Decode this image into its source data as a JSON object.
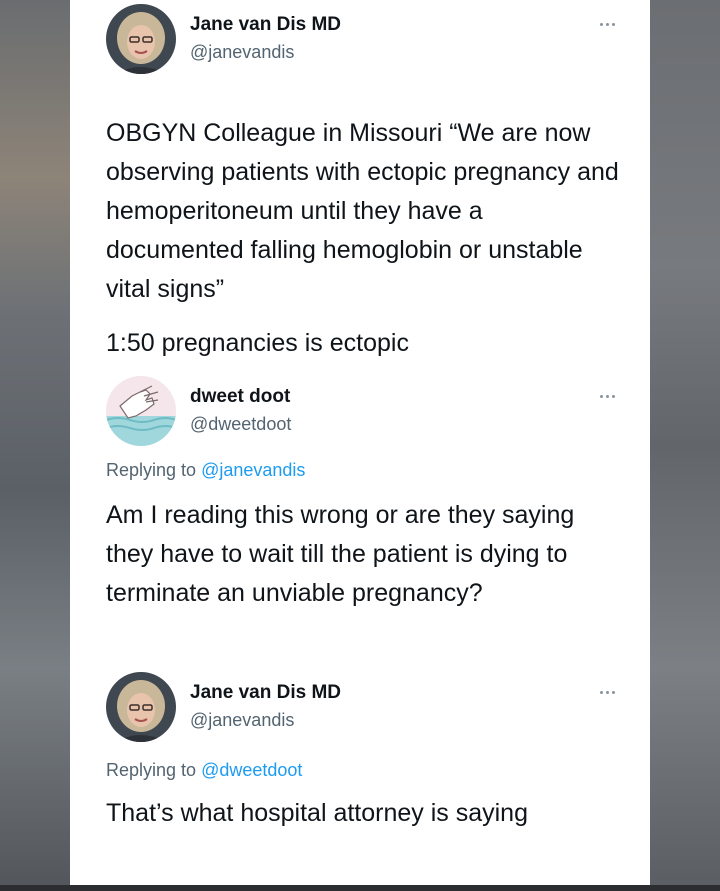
{
  "tweets": [
    {
      "author": "Jane van Dis MD",
      "handle": "@janevandis",
      "avatar": "portrait-photo",
      "more_icon": "more-horizontal-icon",
      "text": "OBGYN Colleague in Missouri “We are now observing patients with ectopic pregnancy and hemoperitoneum until they have a documented falling hemoglobin or unstable vital signs”",
      "text2": "1:50 pregnancies is ectopic"
    },
    {
      "author": "dweet doot",
      "handle": "@dweetdoot",
      "avatar": "hand-illustration",
      "more_icon": "more-horizontal-icon",
      "replying_prefix": "Replying to ",
      "replying_to": "@janevandis",
      "text": "Am I reading this wrong or are they saying they have to wait till the patient is dying to terminate an unviable pregnancy?"
    },
    {
      "author": "Jane van Dis MD",
      "handle": "@janevandis",
      "avatar": "portrait-photo",
      "more_icon": "more-horizontal-icon",
      "replying_prefix": "Replying to ",
      "replying_to": "@dweetdoot",
      "text": "That’s what hospital attorney is saying"
    }
  ],
  "colors": {
    "text": "#0f1419",
    "secondary": "#536471",
    "link": "#1d9bf0"
  }
}
